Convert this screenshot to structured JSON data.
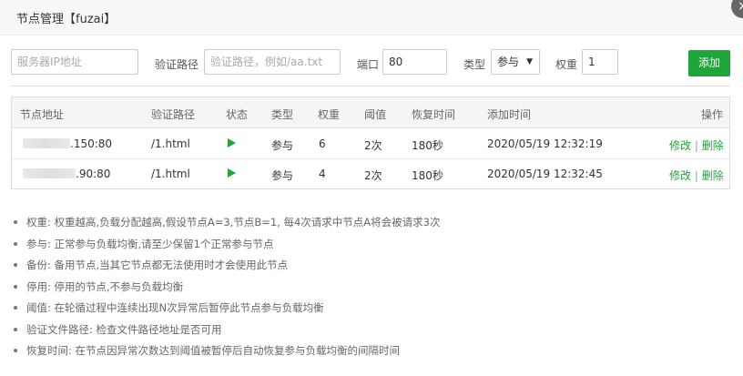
{
  "dialog": {
    "title": "节点管理【fuzai】",
    "close_icon": "×"
  },
  "form": {
    "server_ip_placeholder": "服务器IP地址",
    "verify_path_label": "验证路径",
    "verify_path_placeholder": "验证路径，例如/aa.txt",
    "port_label": "端口",
    "port_value": "80",
    "type_label": "类型",
    "type_value": "参与",
    "weight_label": "权重",
    "weight_value": "1",
    "add_label": "添加"
  },
  "table": {
    "headers": [
      "节点地址",
      "验证路径",
      "状态",
      "类型",
      "权重",
      "阈值",
      "恢复时间",
      "添加时间",
      "操作"
    ],
    "rows": [
      {
        "addr": ".150:80",
        "path": "/1.html",
        "type": "参与",
        "weight": "6",
        "threshold": "2次",
        "recover": "180秒",
        "added": "2020/05/19 12:32:19",
        "edit": "修改",
        "sep": "|",
        "delete": "删除"
      },
      {
        "addr": ".90:80",
        "path": "/1.html",
        "type": "参与",
        "weight": "4",
        "threshold": "2次",
        "recover": "180秒",
        "added": "2020/05/19 12:32:45",
        "edit": "修改",
        "sep": "|",
        "delete": "删除"
      }
    ]
  },
  "tips": [
    "权重: 权重越高,负载分配越高,假设节点A=3,节点B=1, 每4次请求中节点A将会被请求3次",
    "参与: 正常参与负载均衡,请至少保留1个正常参与节点",
    "备份: 备用节点,当其它节点都无法使用时才会使用此节点",
    "停用: 停用的节点,不参与负载均衡",
    "阈值: 在轮循过程中连续出现N次异常后暂停此节点参与负载均衡",
    "验证文件路径: 检查文件路径地址是否可用",
    "恢复时间: 在节点因异常次数达到阈值被暂停后自动恢复参与负载均衡的间隔时间"
  ],
  "colors": {
    "accent": "#20a53a",
    "status_running": "#20a53a"
  }
}
